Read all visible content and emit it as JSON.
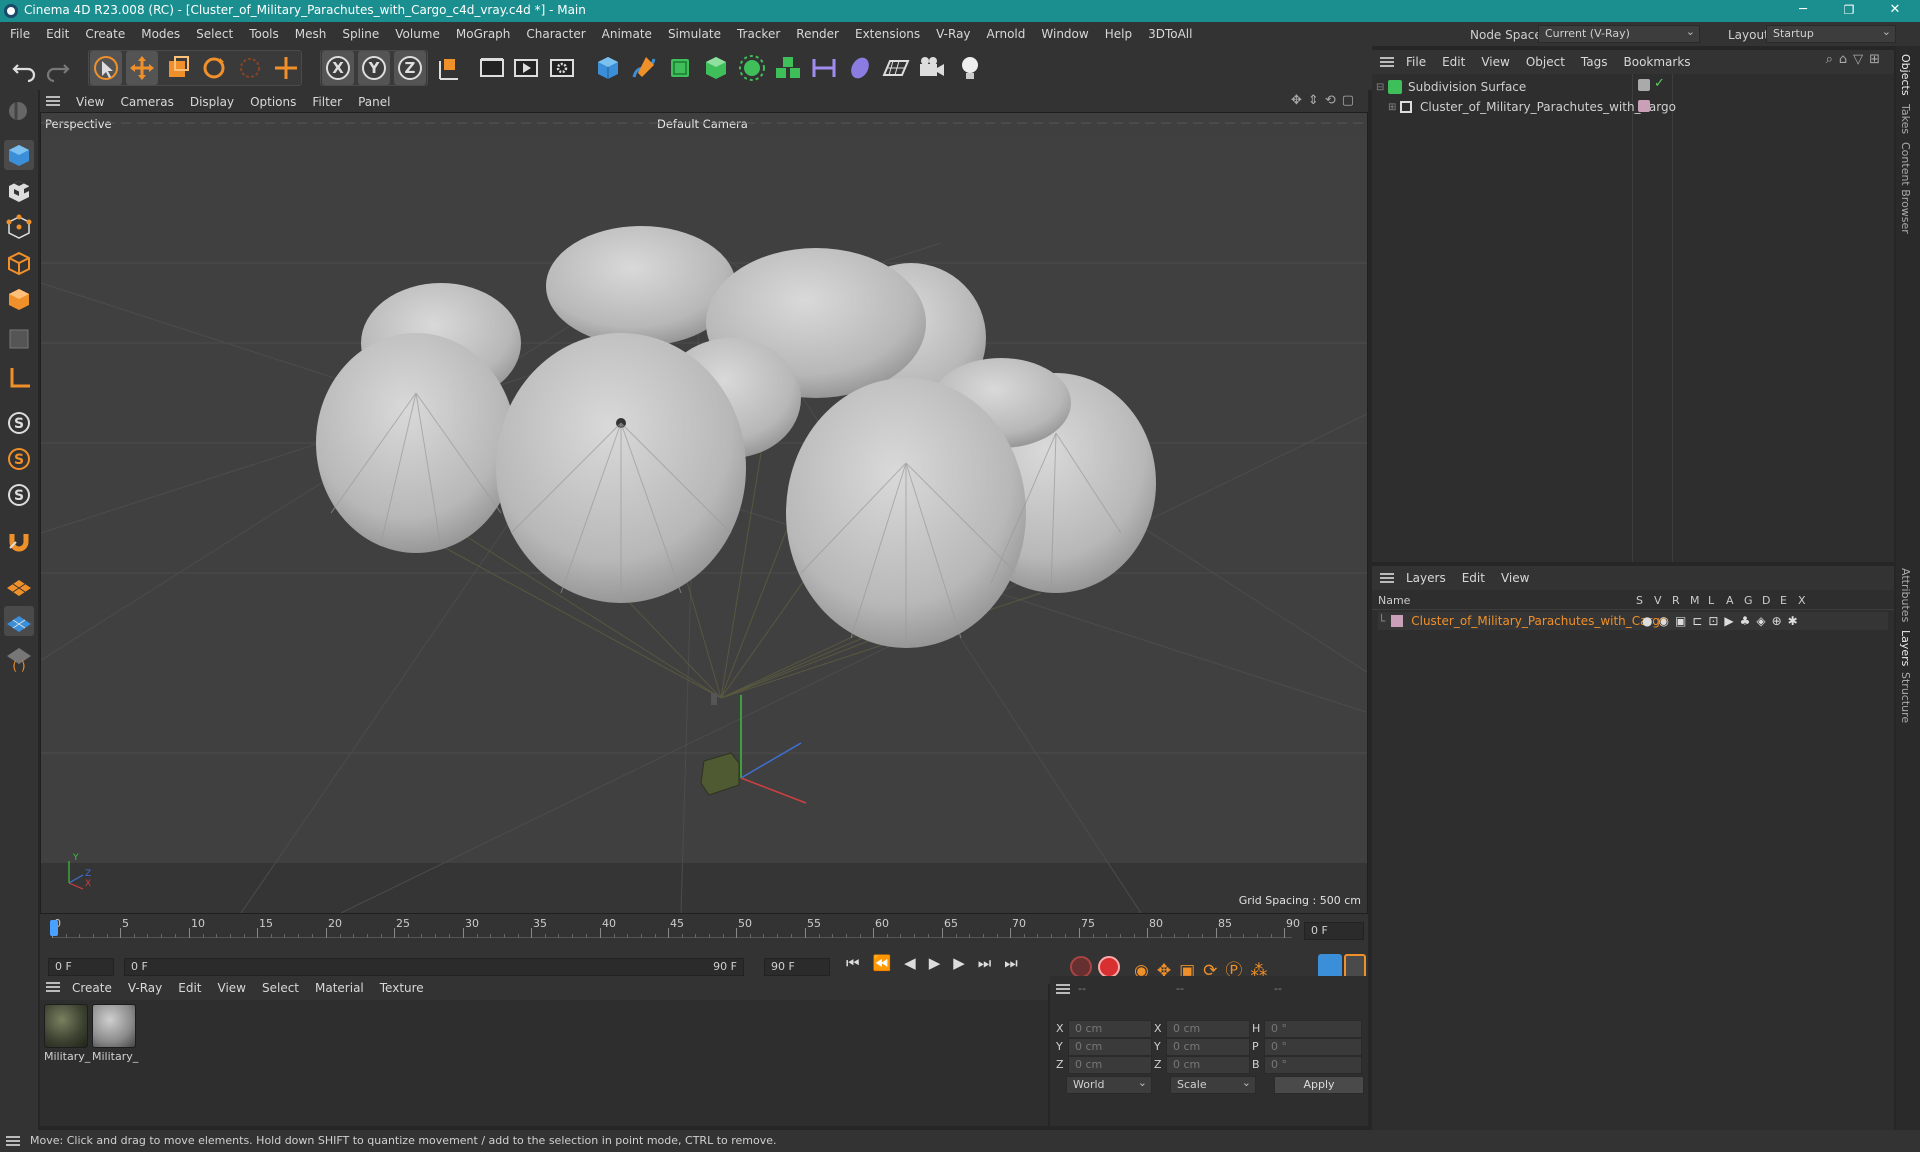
{
  "window": {
    "title": "Cinema 4D R23.008 (RC) - [Cluster_of_Military_Parachutes_with_Cargo_c4d_vray.c4d *] - Main",
    "minimize": "─",
    "restore": "❐",
    "close": "✕"
  },
  "menubar": {
    "items": [
      "File",
      "Edit",
      "Create",
      "Modes",
      "Select",
      "Tools",
      "Mesh",
      "Spline",
      "Volume",
      "MoGraph",
      "Character",
      "Animate",
      "Simulate",
      "Tracker",
      "Render",
      "Extensions",
      "V-Ray",
      "Arnold",
      "Window",
      "Help",
      "3DToAll"
    ],
    "node_space_label": "Node Space:",
    "node_space_value": "Current (V-Ray)",
    "layout_label": "Layout:",
    "layout_value": "Startup"
  },
  "viewport": {
    "menu": [
      "View",
      "Cameras",
      "Display",
      "Options",
      "Filter",
      "Panel"
    ],
    "view_name": "Perspective",
    "camera": "Default Camera",
    "grid_spacing": "Grid Spacing : 500 cm",
    "axis_y": "Y",
    "axis_z": "Z",
    "axis_x": "X"
  },
  "timeline": {
    "ticks": [
      "0",
      "5",
      "10",
      "15",
      "20",
      "25",
      "30",
      "35",
      "40",
      "45",
      "50",
      "55",
      "60",
      "65",
      "70",
      "75",
      "80",
      "85",
      "90"
    ],
    "current_frame_right": "0 F",
    "start_field": "0 F",
    "range_start": "0 F",
    "range_end": "90 F",
    "end_field": "90 F"
  },
  "materials": {
    "menu": [
      "Create",
      "V-Ray",
      "Edit",
      "View",
      "Select",
      "Material",
      "Texture"
    ],
    "items": [
      {
        "label": "Military_"
      },
      {
        "label": "Military_"
      }
    ]
  },
  "coords": {
    "header": [
      "--",
      "--",
      "--"
    ],
    "rows": [
      {
        "a": "X",
        "av": "0 cm",
        "b": "X",
        "bv": "0 cm",
        "c": "H",
        "cv": "0 °"
      },
      {
        "a": "Y",
        "av": "0 cm",
        "b": "Y",
        "bv": "0 cm",
        "c": "P",
        "cv": "0 °"
      },
      {
        "a": "Z",
        "av": "0 cm",
        "b": "Z",
        "bv": "0 cm",
        "c": "B",
        "cv": "0 °"
      }
    ],
    "mode": "World",
    "size_mode": "Scale",
    "apply": "Apply"
  },
  "objects": {
    "menu": [
      "File",
      "Edit",
      "View",
      "Object",
      "Tags",
      "Bookmarks"
    ],
    "tree": [
      {
        "name": "Subdivision Surface"
      },
      {
        "name": "Cluster_of_Military_Parachutes_with_Cargo"
      }
    ]
  },
  "layers": {
    "menu": [
      "Layers",
      "Edit",
      "View"
    ],
    "columns": [
      "Name",
      "S",
      "V",
      "R",
      "M",
      "L",
      "A",
      "G",
      "D",
      "E",
      "X"
    ],
    "rows": [
      {
        "name": "Cluster_of_Military_Parachutes_with_Cargo"
      }
    ]
  },
  "right_tabs": [
    "Objects",
    "Takes",
    "Content Browser",
    "Attributes",
    "Layers",
    "Structure"
  ],
  "status": "Move: Click and drag to move elements. Hold down SHIFT to quantize movement / add to the selection in point mode, CTRL to remove.",
  "colors": {
    "accent": "#f0902a",
    "title_bar": "#1b8f8f",
    "layer_color": "#c9a0b8"
  }
}
